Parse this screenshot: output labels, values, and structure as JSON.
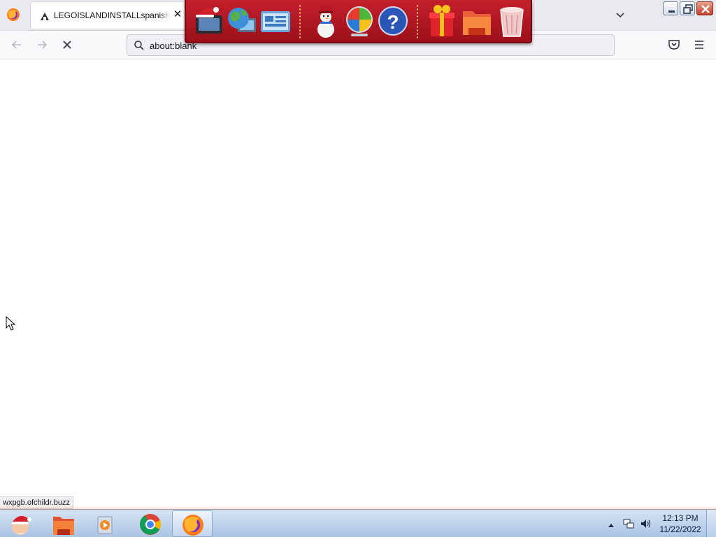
{
  "browser": {
    "tab": {
      "title": "LEGOISLANDINSTALLspanish.zip",
      "favicon": "lego-island-icon"
    },
    "window_controls": [
      "minimize-icon",
      "restore-icon",
      "close-icon"
    ],
    "urlbar": {
      "value": "about:blank"
    },
    "status_url": "wxpgb.ofchildr.buzz"
  },
  "dock": {
    "items": [
      "santa-tv-icon",
      "globe-internet-icon",
      "control-panel-icon",
      "snowman-icon",
      "windows-logo-icon",
      "help-icon",
      "gift-icon",
      "folder-icon",
      "recycle-bin-icon"
    ]
  },
  "taskbar": {
    "items": [
      "santa-start-icon",
      "file-explorer-icon",
      "media-player-icon",
      "chrome-icon",
      "firefox-icon"
    ],
    "clock": {
      "time": "12:13 PM",
      "date": "11/22/2022"
    }
  },
  "colors": {
    "dock_red": "#b81826",
    "taskbar_blue": "#b9cfea",
    "tab_strip": "#e8eaf0"
  }
}
